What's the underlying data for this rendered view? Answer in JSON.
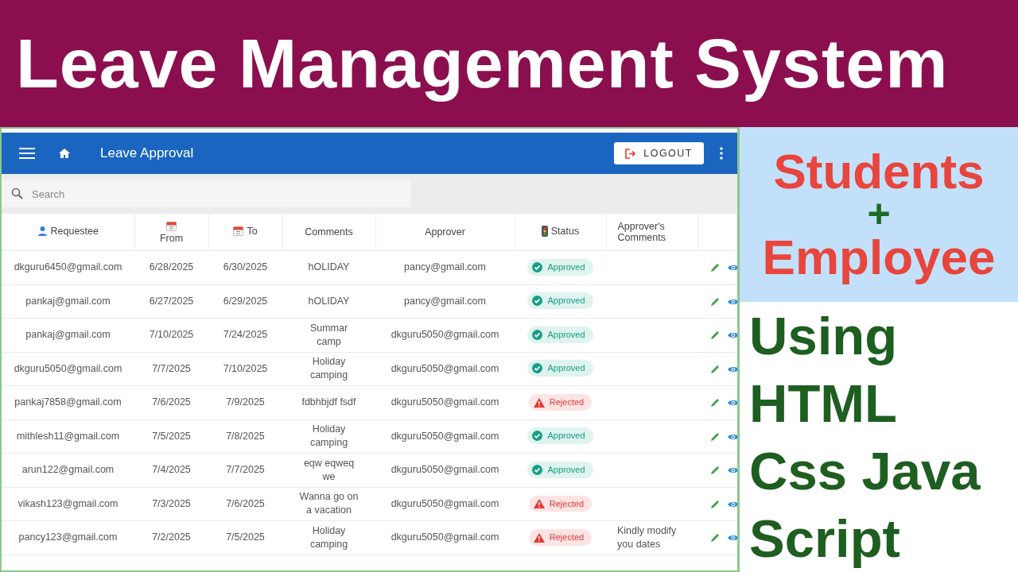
{
  "banner": {
    "title": "Leave Management System"
  },
  "app": {
    "title": "Leave Approval",
    "logout": "LOGOUT",
    "search": {
      "placeholder": "Search"
    },
    "columns": [
      {
        "label": "Requestee"
      },
      {
        "label": "From"
      },
      {
        "label": "To"
      },
      {
        "label": "Comments"
      },
      {
        "label": "Approver"
      },
      {
        "label": "Status"
      },
      {
        "label": "Approver's Comments"
      }
    ],
    "rows": [
      {
        "requestee": "dkguru6450@gmail.com",
        "from": "6/28/2025",
        "to": "6/30/2025",
        "comments": "hOLIDAY",
        "approver": "pancy@gmail.com",
        "status": {
          "kind": "approved",
          "label": "Approved"
        }
      },
      {
        "requestee": "pankaj@gmail.com",
        "from": "6/27/2025",
        "to": "6/29/2025",
        "comments": "hOLIDAY",
        "approver": "pancy@gmail.com",
        "status": {
          "kind": "approved",
          "label": "Approved"
        }
      },
      {
        "requestee": "pankaj@gmail.com",
        "from": "7/10/2025",
        "to": "7/24/2025",
        "comments": "Summar camp",
        "approver": "dkguru5050@gmail.com",
        "status": {
          "kind": "approved",
          "label": "Approved"
        }
      },
      {
        "requestee": "dkguru5050@gmail.com",
        "from": "7/7/2025",
        "to": "7/10/2025",
        "comments": "Holiday camping",
        "approver": "dkguru5050@gmail.com",
        "status": {
          "kind": "approved",
          "label": "Approved"
        }
      },
      {
        "requestee": "pankaj7858@gmail.com",
        "from": "7/6/2025",
        "to": "7/9/2025",
        "comments": "fdbhbjdf fsdf",
        "approver": "dkguru5050@gmail.com",
        "status": {
          "kind": "rejected",
          "label": "Rejected"
        }
      },
      {
        "requestee": "mithlesh11@gmail.com",
        "from": "7/5/2025",
        "to": "7/8/2025",
        "comments": "Holiday camping",
        "approver": "dkguru5050@gmail.com",
        "status": {
          "kind": "approved",
          "label": "Approved"
        }
      },
      {
        "requestee": "arun122@gmail.com",
        "from": "7/4/2025",
        "to": "7/7/2025",
        "comments": "eqw eqweq we",
        "approver": "dkguru5050@gmail.com",
        "status": {
          "kind": "approved",
          "label": "Approved"
        }
      },
      {
        "requestee": "vikash123@gmail.com",
        "from": "7/3/2025",
        "to": "7/6/2025",
        "comments": "Wanna go on a vacation",
        "approver": "dkguru5050@gmail.com",
        "status": {
          "kind": "rejected",
          "label": "Rejected"
        }
      },
      {
        "requestee": "pancy123@gmail.com",
        "from": "7/2/2025",
        "to": "7/5/2025",
        "comments": "Holiday camping",
        "approver": "dkguru5050@gmail.com",
        "status": {
          "kind": "rejected",
          "label": "Rejected"
        },
        "approver_comments": "Kindly modify you dates"
      }
    ]
  },
  "side": {
    "top": [
      "Students",
      "+",
      "Employee"
    ],
    "bottom": "Using HTML Css Java Script"
  }
}
